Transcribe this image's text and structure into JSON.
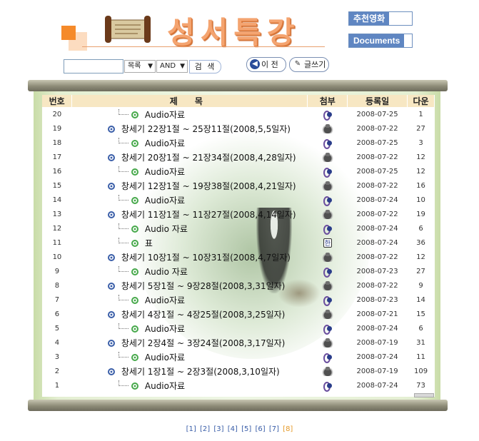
{
  "header": {
    "logo_title": "성서특강",
    "links": [
      {
        "label": "추천영화"
      },
      {
        "label": "Documents"
      }
    ]
  },
  "search": {
    "query": "",
    "field_select": "목록",
    "op_select": "AND",
    "search_label": "검 색",
    "prev_label": "이 전",
    "write_label": "글쓰기"
  },
  "table": {
    "headers": {
      "num": "번호",
      "title": "제 목",
      "attach": "첨부",
      "date": "등록일",
      "hits": "다운"
    },
    "rows": [
      {
        "num": "20",
        "title": "Audio자료",
        "reply": true,
        "attach": "audio",
        "date": "2008-07-25",
        "hits": "1"
      },
      {
        "num": "19",
        "title": "창세기 22장1절 ~ 25장11절(2008,5,5일자)",
        "reply": false,
        "attach": "video",
        "date": "2008-07-22",
        "hits": "27"
      },
      {
        "num": "18",
        "title": "Audio자료",
        "reply": true,
        "attach": "audio",
        "date": "2008-07-25",
        "hits": "3"
      },
      {
        "num": "17",
        "title": "창세기 20장1절 ~ 21장34절(2008,4,28일자)",
        "reply": false,
        "attach": "video",
        "date": "2008-07-22",
        "hits": "12"
      },
      {
        "num": "16",
        "title": "Audio자료",
        "reply": true,
        "attach": "audio",
        "date": "2008-07-25",
        "hits": "12"
      },
      {
        "num": "15",
        "title": "창세기 12장1절 ~ 19장38절(2008,4,21일자)",
        "reply": false,
        "attach": "video",
        "date": "2008-07-22",
        "hits": "16"
      },
      {
        "num": "14",
        "title": "Audio자료",
        "reply": true,
        "attach": "audio",
        "date": "2008-07-24",
        "hits": "10"
      },
      {
        "num": "13",
        "title": "창세기 11장1절 ~ 11장27절(2008,4,14일자)",
        "reply": false,
        "attach": "video",
        "date": "2008-07-22",
        "hits": "19"
      },
      {
        "num": "12",
        "title": "Audio 자료",
        "reply": true,
        "attach": "audio",
        "date": "2008-07-24",
        "hits": "6"
      },
      {
        "num": "11",
        "title": "표",
        "reply": true,
        "attach": "doc",
        "date": "2008-07-24",
        "hits": "36"
      },
      {
        "num": "10",
        "title": "창세기 10장1절 ~ 10장31절(2008,4,7일자)",
        "reply": false,
        "attach": "video",
        "date": "2008-07-22",
        "hits": "12"
      },
      {
        "num": "9",
        "title": "Audio 자료",
        "reply": true,
        "attach": "audio",
        "date": "2008-07-23",
        "hits": "27"
      },
      {
        "num": "8",
        "title": "창세기 5장1절 ~ 9장28절(2008,3,31일자)",
        "reply": false,
        "attach": "video",
        "date": "2008-07-22",
        "hits": "9"
      },
      {
        "num": "7",
        "title": "Audio자료",
        "reply": true,
        "attach": "audio",
        "date": "2008-07-23",
        "hits": "14"
      },
      {
        "num": "6",
        "title": "창세기 4장1절 ~ 4장25절(2008,3,25일자)",
        "reply": false,
        "attach": "video",
        "date": "2008-07-21",
        "hits": "15"
      },
      {
        "num": "5",
        "title": "Audio자료",
        "reply": true,
        "attach": "audio",
        "date": "2008-07-24",
        "hits": "6"
      },
      {
        "num": "4",
        "title": "창세기 2장4절 ~ 3장24절(2008,3,17일자)",
        "reply": false,
        "attach": "video",
        "date": "2008-07-19",
        "hits": "31"
      },
      {
        "num": "3",
        "title": "Audio자료",
        "reply": true,
        "attach": "audio",
        "date": "2008-07-24",
        "hits": "11"
      },
      {
        "num": "2",
        "title": "창세기 1장1절 ~ 2장3절(2008,3,10일자)",
        "reply": false,
        "attach": "video",
        "date": "2008-07-19",
        "hits": "109"
      },
      {
        "num": "1",
        "title": "Audio자료",
        "reply": true,
        "attach": "audio",
        "date": "2008-07-24",
        "hits": "73"
      }
    ]
  },
  "pagination": {
    "pages": [
      "[1]",
      "[2]",
      "[3]",
      "[4]",
      "[5]",
      "[6]",
      "[7]",
      "[8]"
    ],
    "current": "[8]"
  },
  "colors": {
    "accent": "#5f86c2",
    "header_bg": "#f7e7c3",
    "reply_icon": "#46a84a",
    "post_icon": "#3a5ea8"
  }
}
